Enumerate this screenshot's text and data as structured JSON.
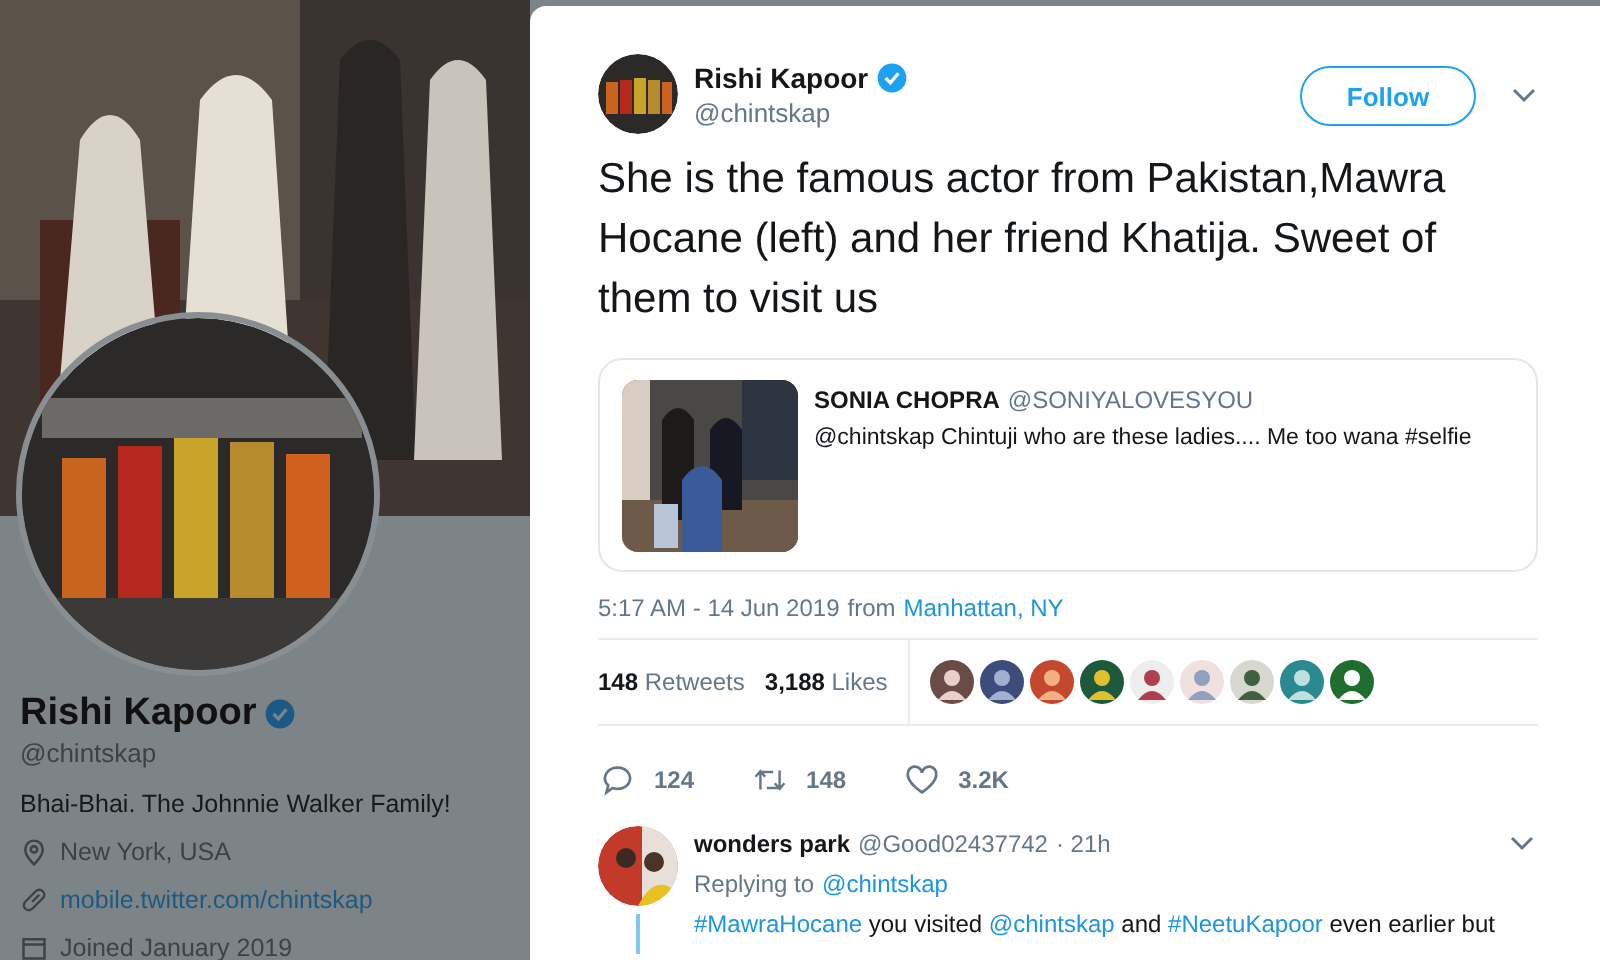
{
  "profile": {
    "name": "Rishi Kapoor",
    "verified": true,
    "handle": "@chintskap",
    "bio": "Bhai-Bhai. The Johnnie Walker Family!",
    "location": "New York, USA",
    "website": "mobile.twitter.com/chintskap",
    "joined": "Joined January 2019"
  },
  "tweet": {
    "author": {
      "name": "Rishi Kapoor",
      "verified": true,
      "handle": "@chintskap"
    },
    "follow_label": "Follow",
    "text": "She is the famous actor from Pakistan,Mawra Hocane (left) and her friend Khatija. Sweet of them to visit us",
    "quote": {
      "name": "SONIA CHOPRA",
      "handle": "@SONIYALOVESYOU",
      "text": "@chintskap Chintuji who are these ladies.... Me too wana #selfie"
    },
    "time": "5:17 AM - 14 Jun 2019",
    "from": "from",
    "place": "Manhattan, NY",
    "retweets": "148",
    "retweets_label": "Retweets",
    "likes": "3,188",
    "likes_label": "Likes",
    "actions": [
      {
        "kind": "reply",
        "count": "124"
      },
      {
        "kind": "retweet",
        "count": "148"
      },
      {
        "kind": "like",
        "count": "3.2K"
      }
    ]
  },
  "reply": {
    "name": "wonders park",
    "handle": "@Good02437742",
    "age": "· 21h",
    "replying_label": "Replying to",
    "replying_to": "@chintskap",
    "text": [
      {
        "text": "#MawraHocane",
        "link": true
      },
      {
        "text": " you visited ",
        "link": false
      },
      {
        "text": "@chintskap",
        "link": true
      },
      {
        "text": " and ",
        "link": false
      },
      {
        "text": "#NeetuKapoor",
        "link": true
      },
      {
        "text": " even earlier but",
        "link": false
      }
    ]
  }
}
